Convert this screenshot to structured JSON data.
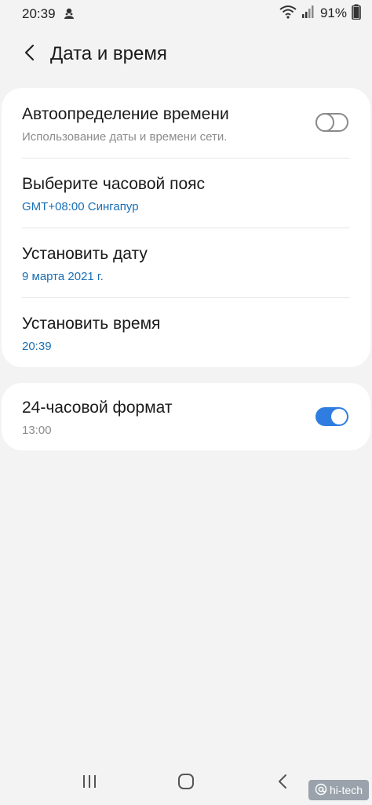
{
  "status_bar": {
    "time": "20:39",
    "battery": "91%"
  },
  "header": {
    "title": "Дата и время"
  },
  "settings": {
    "auto_time": {
      "title": "Автоопределение времени",
      "subtitle": "Использование даты и времени сети.",
      "enabled": false
    },
    "timezone": {
      "title": "Выберите часовой пояс",
      "value": "GMT+08:00 Сингапур"
    },
    "set_date": {
      "title": "Установить дату",
      "value": "9 марта 2021 г."
    },
    "set_time": {
      "title": "Установить время",
      "value": "20:39"
    },
    "format_24h": {
      "title": "24-часовой формат",
      "subtitle": "13:00",
      "enabled": true
    }
  },
  "watermark": {
    "text": "hi-tech"
  },
  "colors": {
    "accent": "#1a6fb5",
    "toggle_on": "#2f7de1",
    "background": "#f3f3f3"
  }
}
